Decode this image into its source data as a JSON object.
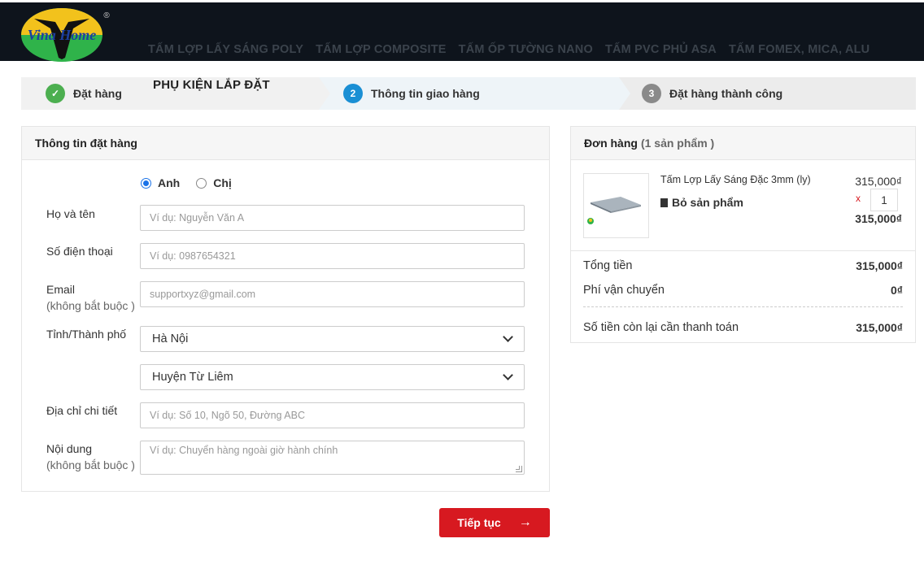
{
  "brand": {
    "logo_text": "Vina Home",
    "registered": "®"
  },
  "nav": {
    "items": [
      "TẤM LỢP LẤY SÁNG POLY",
      "TẤM LỢP COMPOSITE",
      "TẤM ỐP TƯỜNG NANO",
      "TẤM PVC PHỦ ASA",
      "TẤM FOMEX, MICA, ALU"
    ],
    "overlay_item": "PHỤ KIỆN LẮP ĐẶT"
  },
  "steps": [
    {
      "number": "✓",
      "label": "Đặt hàng",
      "state": "done"
    },
    {
      "number": "2",
      "label": "Thông tin giao hàng",
      "state": "active"
    },
    {
      "number": "3",
      "label": "Đặt hàng thành công",
      "state": "todo"
    }
  ],
  "form": {
    "title": "Thông tin đặt hàng",
    "gender": {
      "options": [
        "Anh",
        "Chị"
      ],
      "selected": "Anh"
    },
    "name": {
      "label": "Họ và tên",
      "placeholder": "Ví dụ: Nguyễn Văn A"
    },
    "phone": {
      "label": "Số điện thoại",
      "placeholder": "Ví dụ: 0987654321"
    },
    "email": {
      "label": "Email",
      "sublabel": "(không bắt buộc )",
      "placeholder": "supportxyz@gmail.com"
    },
    "city": {
      "label": "Tỉnh/Thành phố",
      "value": "Hà Nội"
    },
    "district": {
      "value": "Huyện Từ Liêm"
    },
    "address": {
      "label": "Địa chỉ chi tiết",
      "placeholder": "Ví dụ: Số 10, Ngõ 50, Đường ABC"
    },
    "note": {
      "label": "Nội dung",
      "sublabel": "(không bắt buộc )",
      "placeholder": "Ví dụ: Chuyển hàng ngoài giờ hành chính"
    },
    "continue_label": "Tiếp tục",
    "continue_arrow": "→"
  },
  "order": {
    "title": "Đơn hàng",
    "count": "(1 sản phẩm )",
    "product": {
      "name": "Tấm Lợp Lấy Sáng Đặc 3mm (ly)",
      "remove_label": "Bỏ sản phẩm",
      "unit_price": "315,000₫",
      "qty_x": "x",
      "qty": "1",
      "line_total": "315,000₫"
    },
    "subtotal": {
      "label": "Tổng tiền",
      "value": "315,000₫"
    },
    "shipping": {
      "label": "Phí vận chuyển",
      "value": "0₫"
    },
    "remaining": {
      "label": "Số tiền còn lại cần thanh toán",
      "value": "315,000₫"
    }
  },
  "colors": {
    "primary_red": "#d71920",
    "step_active": "#1a8fd4",
    "step_done": "#4caf50",
    "header_bg": "#0e141c"
  }
}
